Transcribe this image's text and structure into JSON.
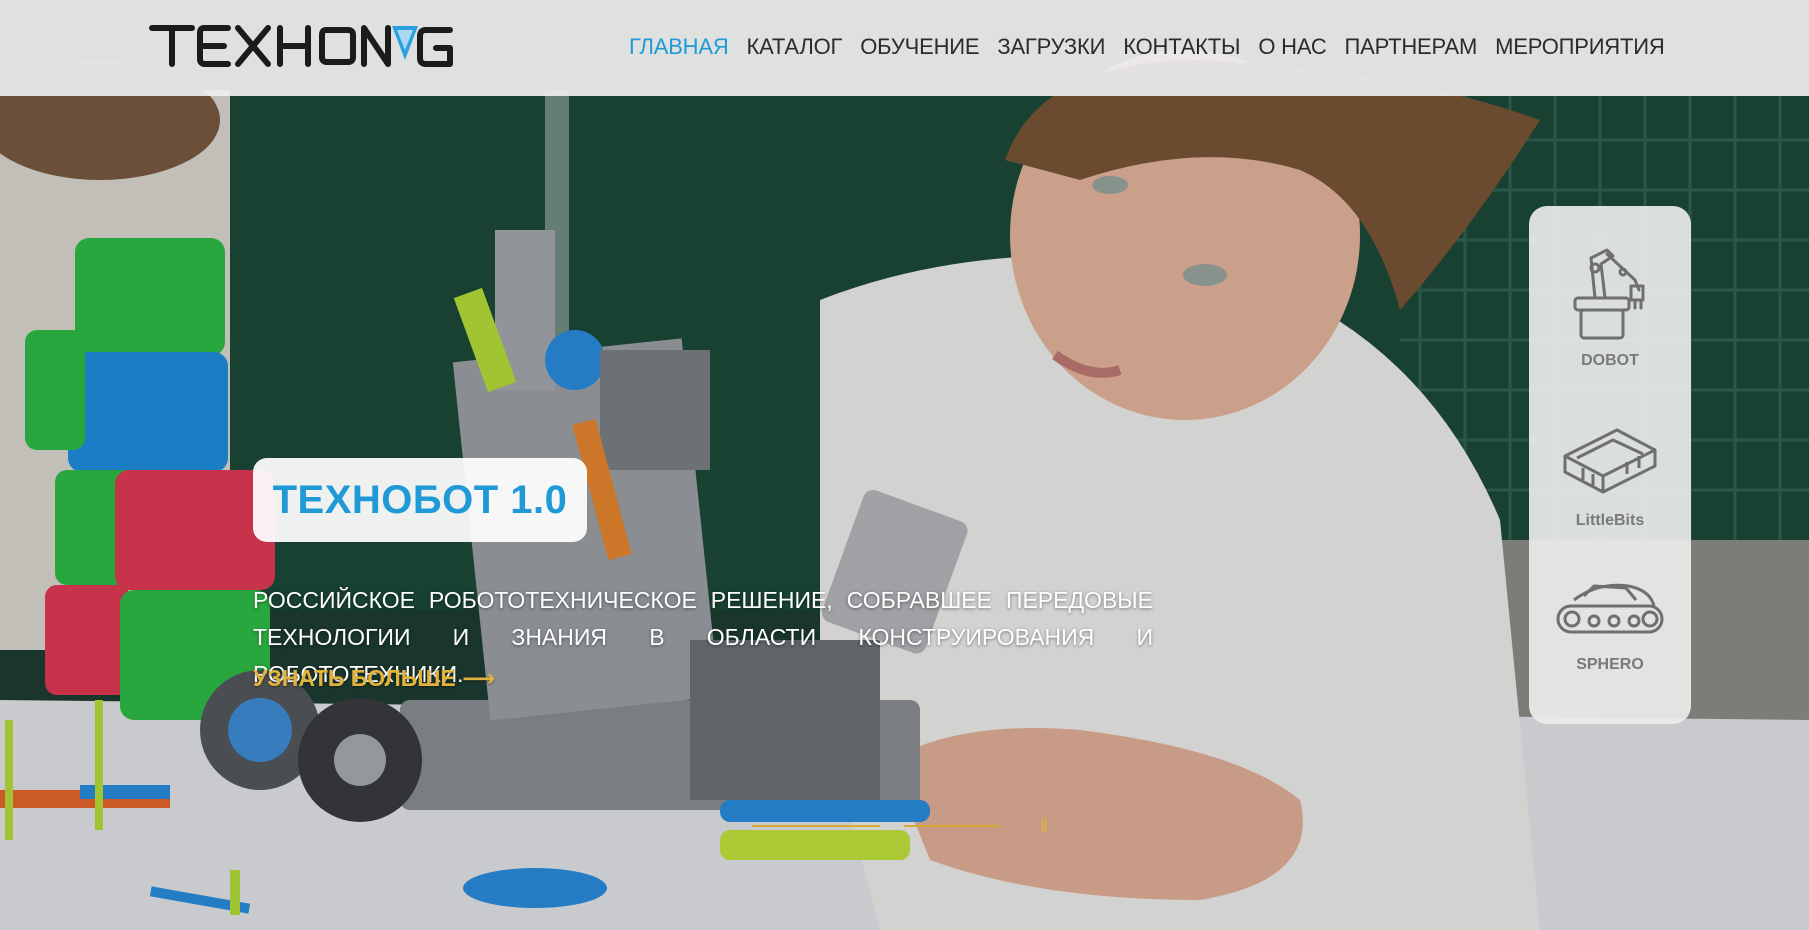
{
  "logo": {
    "text": "TEXHONAG"
  },
  "nav": {
    "items": [
      {
        "label": "ГЛАВНАЯ"
      },
      {
        "label": "КАТАЛОГ"
      },
      {
        "label": "ОБУЧЕНИЕ"
      },
      {
        "label": "ЗАГРУЗКИ"
      },
      {
        "label": "КОНТАКТЫ"
      },
      {
        "label": "О НАС"
      },
      {
        "label": "ПАРТНЕРАМ"
      },
      {
        "label": "МЕРОПРИЯТИЯ"
      }
    ],
    "active_index": 0
  },
  "hero": {
    "title": "ТЕХНОБОТ 1.0",
    "description": "РОССИЙСКОЕ РОБОТОТЕХНИЧЕСКОЕ РЕШЕНИЕ, СОБРАВШЕЕ ПЕРЕДОВЫЕ ТЕХНОЛОГИИ И ЗНАНИЯ В ОБЛАСТИ КОНСТРУИРОВАНИЯ И РОБОТОТЕХНИКИ.",
    "more_link": "УЗНАТЬ БОЛЬШЕ ⟶",
    "pause_icon": "‖"
  },
  "brands": [
    {
      "name": "DOBOT",
      "icon": "robot-arm-icon"
    },
    {
      "name": "LittleBits",
      "icon": "circuit-module-icon"
    },
    {
      "name": "SPHERO",
      "icon": "tracked-robot-icon"
    }
  ],
  "colors": {
    "accent_blue": "#1f9ad6",
    "accent_gold": "#e2b33c",
    "header_bg": "#eeeeee"
  }
}
